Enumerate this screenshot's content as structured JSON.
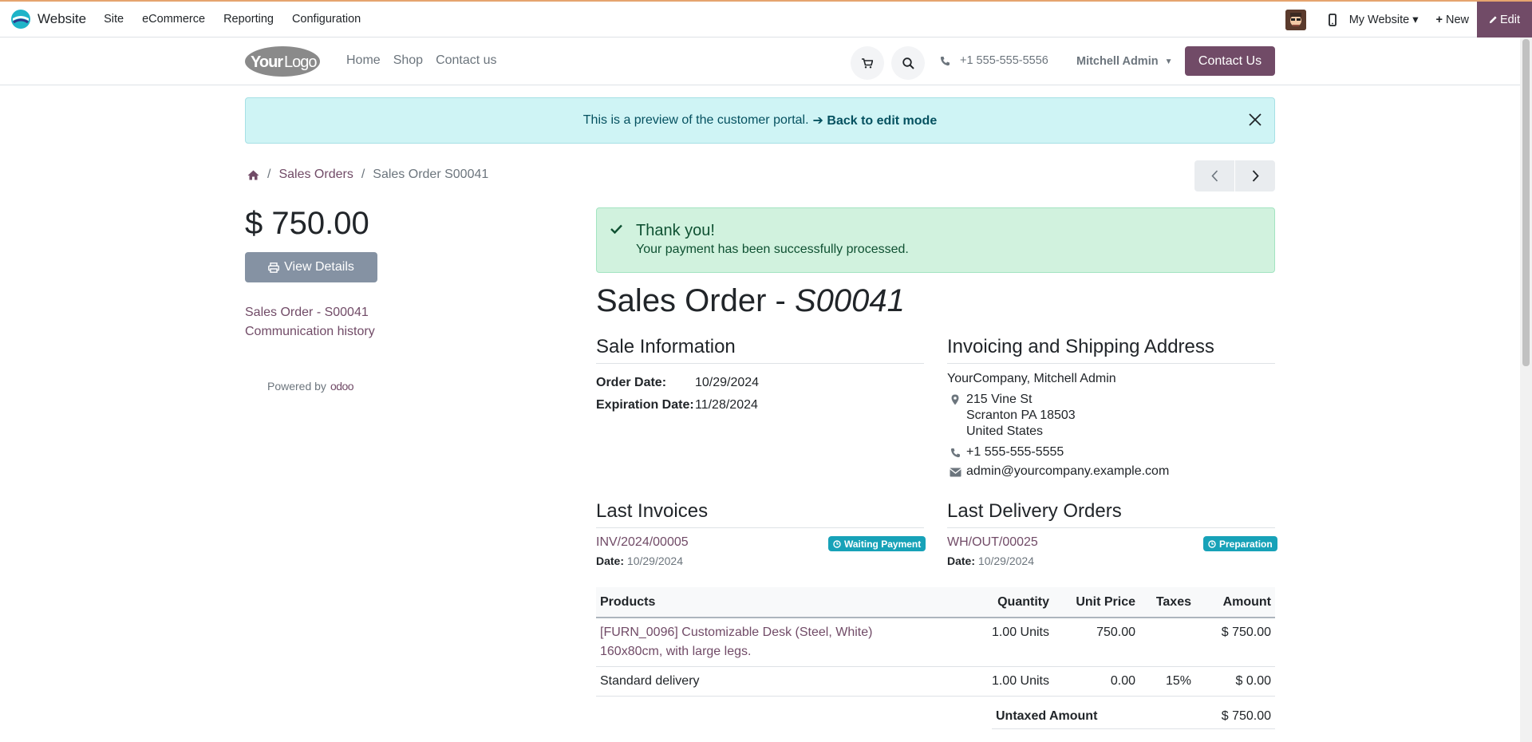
{
  "admin_bar": {
    "app_name": "Website",
    "menu": [
      "Site",
      "eCommerce",
      "Reporting",
      "Configuration"
    ],
    "website_selector": "My Website",
    "new_label": "New",
    "edit_label": "Edit"
  },
  "site_header": {
    "logo_text": "YourLogo",
    "nav": [
      "Home",
      "Shop",
      "Contact us"
    ],
    "phone": "+1 555-555-5556",
    "user": "Mitchell Admin",
    "contact_button": "Contact Us"
  },
  "preview_alert": {
    "text": "This is a preview of the customer portal.",
    "link": "Back to edit mode"
  },
  "breadcrumb": {
    "sales_orders": "Sales Orders",
    "current": "Sales Order S00041"
  },
  "sidebar": {
    "total": "$ 750.00",
    "view_details": "View Details",
    "links": [
      "Sales Order - S00041",
      "Communication history"
    ],
    "powered_by": "Powered by",
    "powered_brand": "odoo"
  },
  "success": {
    "title": "Thank you!",
    "message": "Your payment has been successfully processed."
  },
  "order": {
    "title_prefix": "Sales Order - ",
    "title_ref": "S00041",
    "sale_info_heading": "Sale Information",
    "order_date_label": "Order Date:",
    "order_date": "10/29/2024",
    "expiration_label": "Expiration Date:",
    "expiration_date": "11/28/2024",
    "address_heading": "Invoicing and Shipping Address",
    "customer": "YourCompany, Mitchell Admin",
    "street": "215 Vine St",
    "city": "Scranton PA 18503",
    "country": "United States",
    "phone": "+1 555-555-5555",
    "email": "admin@yourcompany.example.com",
    "invoices_heading": "Last Invoices",
    "invoice_ref": "INV/2024/00005",
    "invoice_status": "Waiting Payment",
    "invoice_date_label": "Date:",
    "invoice_date": "10/29/2024",
    "delivery_heading": "Last Delivery Orders",
    "delivery_ref": "WH/OUT/00025",
    "delivery_status": "Preparation",
    "delivery_date_label": "Date:",
    "delivery_date": "10/29/2024"
  },
  "products_table": {
    "headers": [
      "Products",
      "Quantity",
      "Unit Price",
      "Taxes",
      "Amount"
    ],
    "rows": [
      {
        "product_line1": "[FURN_0096] Customizable Desk (Steel, White)",
        "product_line2": "160x80cm, with large legs.",
        "quantity": "1.00 Units",
        "unit_price": "750.00",
        "taxes": "",
        "amount": "$ 750.00"
      },
      {
        "product_line1": "Standard delivery",
        "product_line2": "",
        "quantity": "1.00 Units",
        "unit_price": "0.00",
        "taxes": "15%",
        "amount": "$ 0.00"
      }
    ]
  },
  "totals": {
    "untaxed_label": "Untaxed Amount",
    "untaxed_value": "$ 750.00"
  },
  "colors": {
    "brand": "#714b67",
    "info_badge": "#17a2b8",
    "success_bg": "#d1f2de"
  }
}
